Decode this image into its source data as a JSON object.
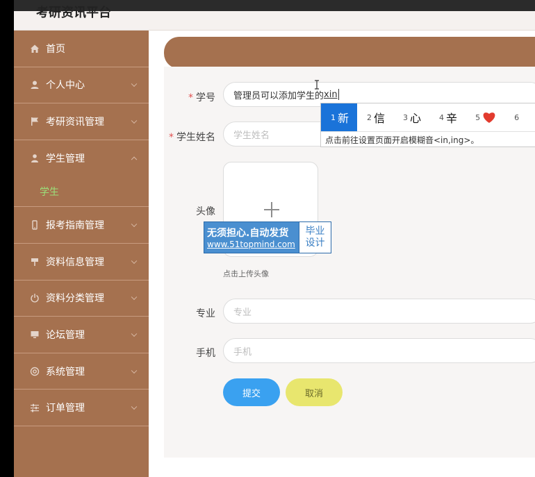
{
  "app": {
    "title": "考研资讯平台"
  },
  "sidebar": {
    "items": [
      {
        "label": "首页",
        "icon": "home-icon"
      },
      {
        "label": "个人中心",
        "icon": "user-icon"
      },
      {
        "label": "考研资讯管理",
        "icon": "flag-icon"
      },
      {
        "label": "学生管理",
        "icon": "student-icon",
        "expanded": true,
        "sub": [
          "学生"
        ]
      },
      {
        "label": "报考指南管理",
        "icon": "phone-icon"
      },
      {
        "label": "资料信息管理",
        "icon": "sign-icon"
      },
      {
        "label": "资料分类管理",
        "icon": "power-icon"
      },
      {
        "label": "论坛管理",
        "icon": "monitor-icon"
      },
      {
        "label": "系统管理",
        "icon": "gear-icon"
      },
      {
        "label": "订单管理",
        "icon": "sliders-icon"
      }
    ],
    "active_sub_label": "学生"
  },
  "form": {
    "student_id": {
      "label": "学号",
      "typed": "管理员可以添加学生的",
      "composing": "xin"
    },
    "student_name": {
      "label": "学生姓名",
      "placeholder": "学生姓名"
    },
    "avatar": {
      "label": "头像",
      "hint": "点击上传头像"
    },
    "major": {
      "label": "专业",
      "placeholder": "专业"
    },
    "phone": {
      "label": "手机",
      "placeholder": "手机"
    },
    "submit_label": "提交",
    "cancel_label": "取消"
  },
  "ime": {
    "candidates": [
      {
        "num": "1",
        "char": "新"
      },
      {
        "num": "2",
        "char": "信"
      },
      {
        "num": "3",
        "char": "心"
      },
      {
        "num": "4",
        "char": "辛"
      },
      {
        "num": "5",
        "char": "heart-emoji"
      },
      {
        "num": "6",
        "char": ""
      }
    ],
    "hint": "点击前往设置页面开启模糊音<in,ing>。"
  },
  "watermark": {
    "line1": "无须担心.自动发货",
    "line2": "www.51topmind.com",
    "right1": "毕业",
    "right2": "设计"
  },
  "colors": {
    "sidebar": "#a5714f",
    "active_sub": "#9be07a",
    "submit": "#3aa1f0",
    "cancel": "#e8e66e",
    "ime_selected": "#1a73d9"
  }
}
